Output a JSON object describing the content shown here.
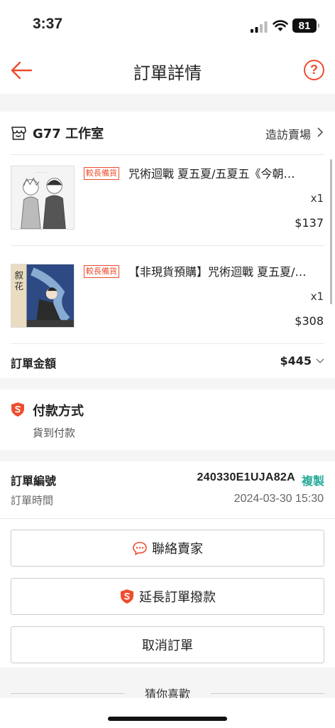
{
  "status_bar": {
    "time": "3:37",
    "battery": "81"
  },
  "nav": {
    "title": "訂單詳情",
    "help_label": "?"
  },
  "shop": {
    "name": "G77 工作室",
    "visit_label": "造訪賣場",
    "products": [
      {
        "badge": "較長備貨",
        "name": "咒術迴戰 夏五夏/五夏五《今朝…",
        "qty": "x1",
        "price": "$137"
      },
      {
        "badge": "較長備貨",
        "name": "【非現貨預購】咒術迴戰 夏五夏/…",
        "qty": "x1",
        "price": "$308"
      }
    ],
    "total_label": "訂單金額",
    "total_value": "$445"
  },
  "payment": {
    "title": "付款方式",
    "method": "貨到付款"
  },
  "order": {
    "number_label": "訂單編號",
    "number": "240330E1UJA82A",
    "copy_label": "複製",
    "time_label": "訂單時間",
    "time": "2024-03-30 15:30"
  },
  "actions": {
    "contact_seller": "聯絡賣家",
    "extend_payout": "延長訂單撥款",
    "cancel_order": "取消訂單"
  },
  "recommend": {
    "title": "猜你喜歡"
  },
  "colors": {
    "accent": "#ee4d2d",
    "copy": "#26aa99"
  },
  "icons": [
    "back-arrow-icon",
    "help-icon",
    "shop-icon",
    "chevron-right-icon",
    "chevron-down-icon",
    "shield-icon",
    "chat-icon"
  ]
}
